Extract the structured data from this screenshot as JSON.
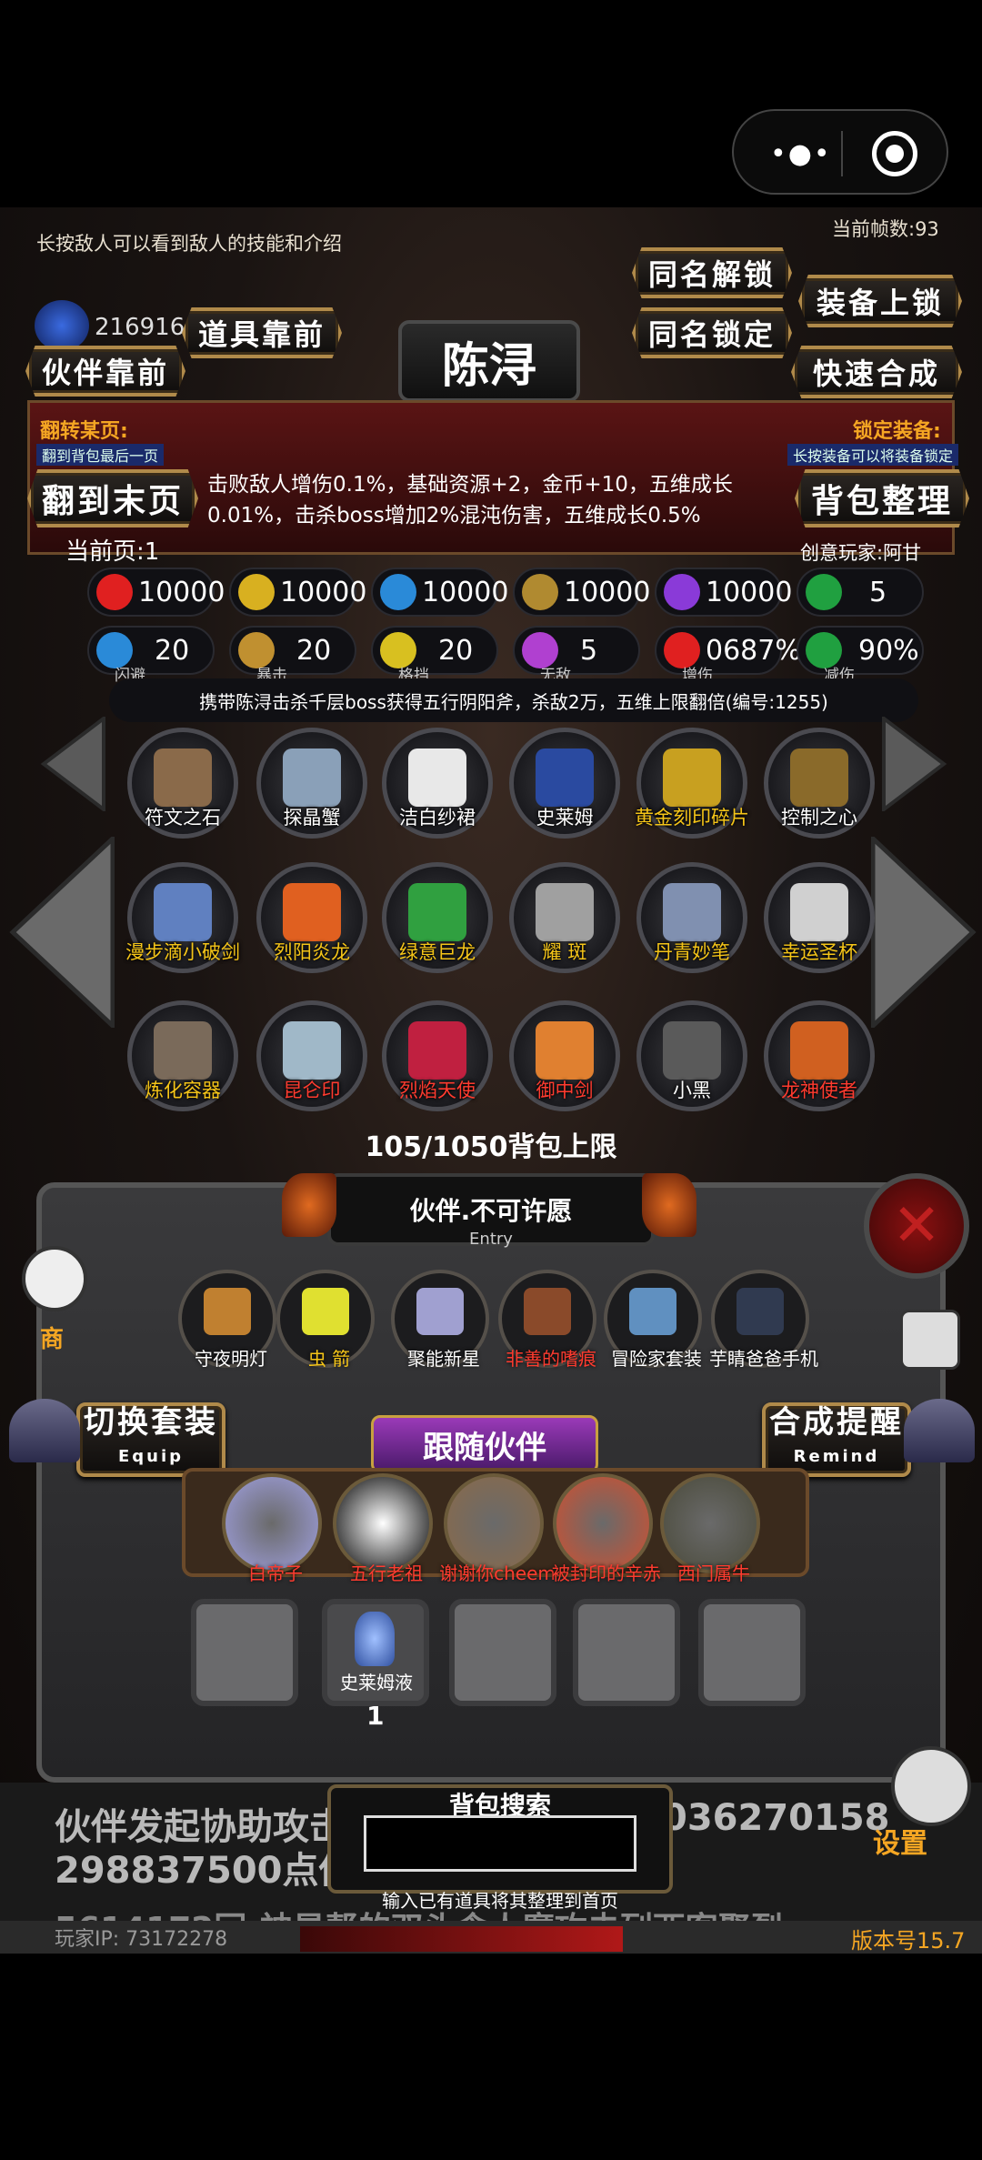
{
  "fps": "当前帧数:93",
  "tip_top": "长按敌人可以看到敌人的技能和介绍",
  "gems": "216916",
  "buttons": {
    "same_name_unlock": "同名解锁",
    "equip_lock": "装备上锁",
    "item_front": "道具靠前",
    "same_name_lock": "同名锁定",
    "partner_front": "伙伴靠前",
    "quick_merge": "快速合成",
    "goto_last": "翻到末页",
    "bag_sort": "背包整理",
    "switch_set": "切换套装",
    "switch_set_sub": "Equip",
    "merge_remind": "合成提醒",
    "merge_remind_sub": "Remind",
    "follow_partner": "跟随伙伴"
  },
  "character_name": "陈浔",
  "flip": {
    "title": "翻转某页:",
    "sub": "翻到背包最后一页"
  },
  "lock_equip": {
    "title": "锁定装备:",
    "sub": "长按装备可以将装备锁定"
  },
  "description": "击败敌人增伤0.1%，基础资源+2，金币+10，五维成长0.01%，击杀boss增加2%混沌伤害，五维成长0.5%",
  "current_page": "当前页:1",
  "creator": "创意玩家:阿甘",
  "stats_row1": [
    {
      "icon": "heart-icon",
      "value": "10000",
      "color": "#e02020"
    },
    {
      "icon": "strength-icon",
      "value": "10000",
      "color": "#d8b020"
    },
    {
      "icon": "speed-icon",
      "value": "10000",
      "color": "#2a8ad8"
    },
    {
      "icon": "sword-icon",
      "value": "10000",
      "color": "#b08a30"
    },
    {
      "icon": "lightning-icon",
      "value": "10000",
      "color": "#8a3ad8"
    },
    {
      "icon": "clover-icon",
      "value": "5",
      "color": "#20a040"
    }
  ],
  "stats_row2": [
    {
      "icon": "dodge-icon",
      "value": "20",
      "label": "闪避",
      "color": "#2a8ad8"
    },
    {
      "icon": "crit-icon",
      "value": "20",
      "label": "暴击",
      "color": "#c09030"
    },
    {
      "icon": "shield-icon",
      "value": "20",
      "label": "格挡",
      "color": "#d8c020"
    },
    {
      "icon": "invincible-icon",
      "value": "5",
      "label": "无敌",
      "color": "#b040d0"
    },
    {
      "icon": "damage-up-icon",
      "value": "0687%",
      "label": "增伤",
      "color": "#e02020"
    },
    {
      "icon": "damage-reduce-icon",
      "value": "90%",
      "label": "减伤",
      "color": "#20a040"
    }
  ],
  "boss_note": "携带陈浔击杀千层boss获得五行阴阳斧，杀敌2万，五维上限翻倍(编号:1255)",
  "items": [
    {
      "label": "符文之石",
      "color": "white",
      "gfx": "#8a6a4a"
    },
    {
      "label": "探晶蟹",
      "color": "white",
      "gfx": "#8aa0b8"
    },
    {
      "label": "洁白纱裙",
      "color": "white",
      "gfx": "#e8e8e8"
    },
    {
      "label": "史莱姆",
      "color": "white",
      "gfx": "#2a4aa0"
    },
    {
      "label": "黄金刻印碎片",
      "color": "yel",
      "gfx": "#c8a020"
    },
    {
      "label": "控制之心",
      "color": "white",
      "gfx": "#8a6a2a"
    },
    {
      "label": "漫步滴小破剑",
      "color": "yel",
      "gfx": "#6080c0"
    },
    {
      "label": "烈阳炎龙",
      "color": "yel",
      "gfx": "#e06020"
    },
    {
      "label": "绿意巨龙",
      "color": "yel",
      "gfx": "#30a040"
    },
    {
      "label": "耀 斑",
      "color": "yel",
      "gfx": "#a0a0a0"
    },
    {
      "label": "丹青妙笔",
      "color": "yel",
      "gfx": "#8090b0"
    },
    {
      "label": "幸运圣杯",
      "color": "yel",
      "gfx": "#d0d0d0"
    },
    {
      "label": "炼化容器",
      "color": "yel",
      "gfx": "#7a6a5a"
    },
    {
      "label": "昆仑印",
      "color": "red",
      "gfx": "#a0b8c8"
    },
    {
      "label": "烈焰天使",
      "color": "red",
      "gfx": "#c02040"
    },
    {
      "label": "御中剑",
      "color": "red",
      "gfx": "#e08030"
    },
    {
      "label": "小黑",
      "color": "white",
      "gfx": "#5a5a5a"
    },
    {
      "label": "龙神使者",
      "color": "red",
      "gfx": "#d06020"
    }
  ],
  "bag_limit": "105/1050背包上限",
  "entry_title": "伙伴.不可许愿",
  "entry_sub": "Entry",
  "shop_label": "商",
  "components": [
    {
      "label": "守夜明灯",
      "color": "#c08030"
    },
    {
      "label": "虫 箭",
      "color": "#e0e030"
    },
    {
      "label": "聚能新星",
      "color": "#a0a0d0"
    },
    {
      "label": "非善的嗜痕",
      "color": "#8a4a2a"
    },
    {
      "label": "冒险家套装",
      "color": "#6090c0"
    },
    {
      "label": "芋睛爸爸手机",
      "color": "#303a50"
    }
  ],
  "partners": [
    {
      "label": "白帝子",
      "color": "#a0a0e0"
    },
    {
      "label": "五行老祖",
      "color": "#000000"
    },
    {
      "label": "谢谢你cheem",
      "color": "#8a6a4a"
    },
    {
      "label": "被封印的辛赤",
      "color": "#d05030"
    },
    {
      "label": "西门属牛",
      "color": "#4a4a3a"
    }
  ],
  "inventory": {
    "item_label": "史莱姆液",
    "count": "1"
  },
  "log_line1": "伙伴发起协助攻击",
  "log_line1_right": "036270158",
  "log_line2": "298837500点伤害",
  "log_line3": "5614172回:神星帮的双头食人魔攻击列西客聚烈",
  "bag_search": "背包搜索",
  "search_hint": "输入已有道具将其整理到首页",
  "settings": "设置",
  "player_ip": "玩家IP:  73172278",
  "version": "版本号15.7",
  "accent_gold": "#b08a4a",
  "accent_orange": "#f5a623",
  "accent_purple": "#7a2a9a"
}
